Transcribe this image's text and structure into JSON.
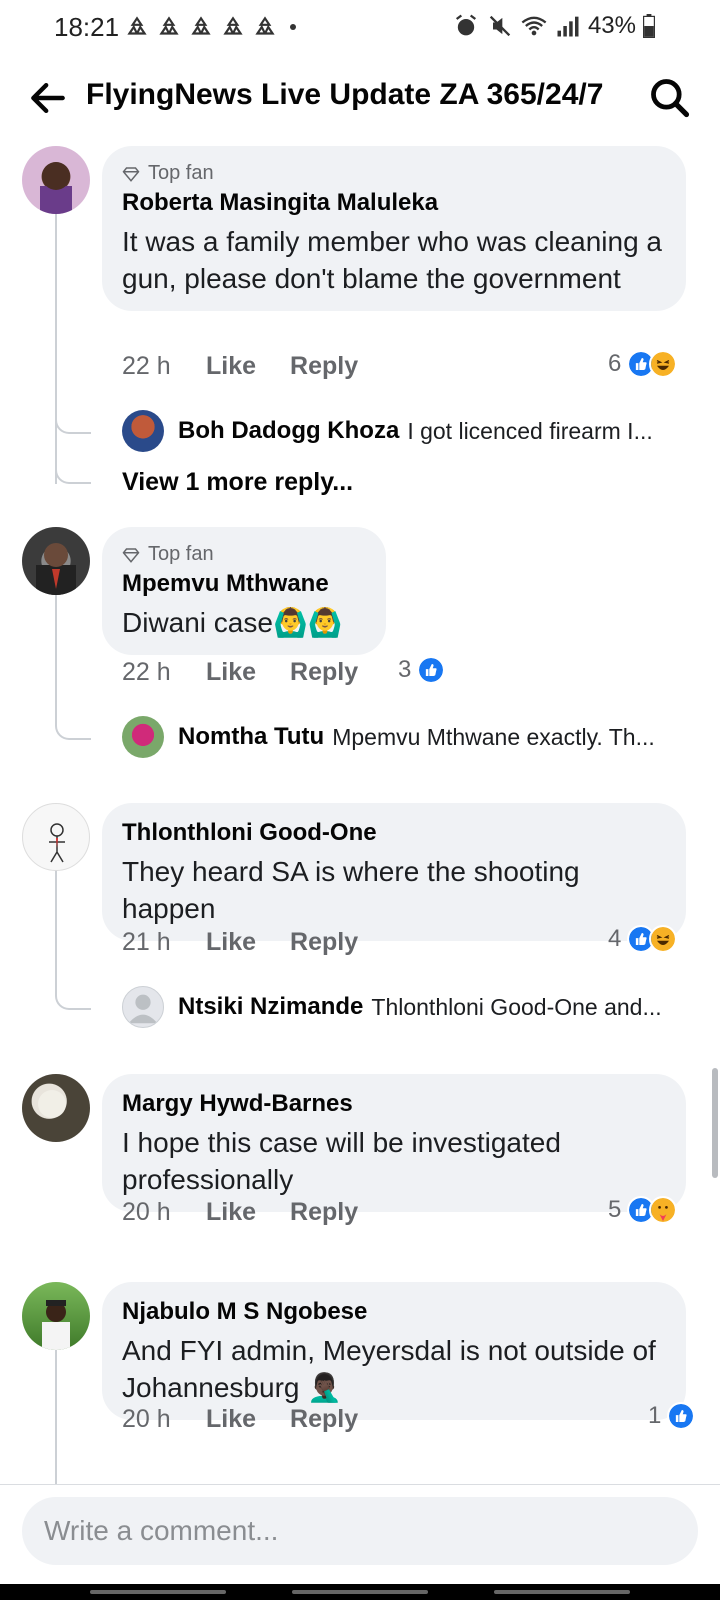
{
  "status_bar": {
    "time": "18:21",
    "battery": "43%"
  },
  "header": {
    "title": "FlyingNews Live Update ZA 365/24/7"
  },
  "comments": [
    {
      "badge": "Top fan",
      "author": "Roberta Masingita Maluleka",
      "text": "It was a family member who was cleaning a gun, please don't blame the government",
      "time": "22 h",
      "like": "Like",
      "reply": "Reply",
      "reaction_count": "6",
      "reactions": [
        "like-icon",
        "haha-icon"
      ],
      "replies": [
        {
          "author": "Boh Dadogg Khoza",
          "snippet": "I got licenced firearm I..."
        }
      ],
      "more_replies": "View 1 more reply..."
    },
    {
      "badge": "Top fan",
      "author": "Mpemvu Mthwane",
      "text": "Diwani case🙆‍♂️🙆‍♂️",
      "time": "22 h",
      "like": "Like",
      "reply": "Reply",
      "reaction_count": "3",
      "reactions": [
        "like-icon"
      ],
      "replies": [
        {
          "author": "Nomtha Tutu",
          "snippet": "Mpemvu Mthwane exactly. Th..."
        }
      ]
    },
    {
      "author": "Thlonthloni Good-One",
      "text": "They heard SA is where the shooting happen",
      "time": "21 h",
      "like": "Like",
      "reply": "Reply",
      "reaction_count": "4",
      "reactions": [
        "like-icon",
        "haha-icon"
      ],
      "replies": [
        {
          "author": "Ntsiki Nzimande",
          "snippet": "Thlonthloni Good-One and..."
        }
      ]
    },
    {
      "author": "Margy Hywd-Barnes",
      "text": "I hope this case will be investigated professionally",
      "time": "20 h",
      "like": "Like",
      "reply": "Reply",
      "reaction_count": "5",
      "reactions": [
        "like-icon",
        "care-icon"
      ]
    },
    {
      "author": "Njabulo M S Ngobese",
      "text": "And FYI admin, Meyersdal is not outside of Johannesburg 🤦🏿‍♂️",
      "time": "20 h",
      "like": "Like",
      "reply": "Reply",
      "reaction_count": "1",
      "reactions": [
        "like-icon"
      ]
    }
  ],
  "composer": {
    "placeholder": "Write a comment..."
  },
  "colors": {
    "bubble": "#f0f2f5",
    "meta_text": "#65676b",
    "like_blue": "#1877f2",
    "haha_yellow": "#f7b125"
  }
}
